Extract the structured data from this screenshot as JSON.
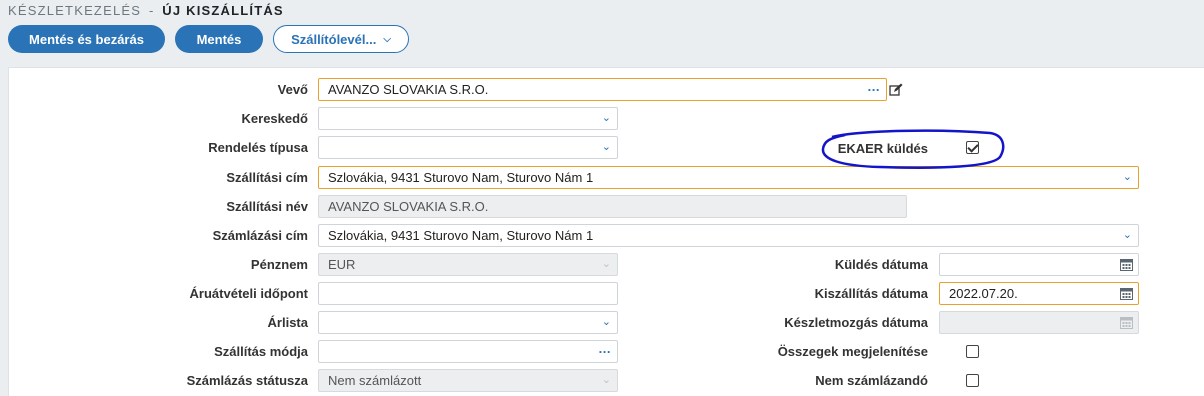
{
  "breadcrumb": {
    "parent": "KÉSZLETKEZELÉS",
    "separator": "-",
    "current": "ÚJ KISZÁLLÍTÁS"
  },
  "toolbar": {
    "save_close_label": "Mentés és bezárás",
    "save_label": "Mentés",
    "delivery_note_label": "Szállítólevél...",
    "chevron_icon": "chevron-down-icon"
  },
  "form": {
    "vevo": {
      "label": "Vevő",
      "value": "AVANZO SLOVAKIA S.R.O."
    },
    "kereskedo": {
      "label": "Kereskedő",
      "value": ""
    },
    "rendeles_tipusa": {
      "label": "Rendelés típusa",
      "value": ""
    },
    "ekaer": {
      "label": "EKAER küldés",
      "checked": true
    },
    "szallitasi_cim": {
      "label": "Szállítási cím",
      "value": "Szlovákia, 9431 Sturovo Nam, Sturovo Nám 1"
    },
    "szallitasi_nev": {
      "label": "Szállítási név",
      "value": "AVANZO SLOVAKIA S.R.O."
    },
    "szamlazasi_cim": {
      "label": "Számlázási cím",
      "value": "Szlovákia, 9431 Sturovo Nam, Sturovo Nám 1"
    },
    "penznem": {
      "label": "Pénznem",
      "value": "EUR"
    },
    "aruatveteli_idopont": {
      "label": "Áruátvételi időpont",
      "value": ""
    },
    "arlista": {
      "label": "Árlista",
      "value": ""
    },
    "szallitas_modja": {
      "label": "Szállítás módja",
      "value": ""
    },
    "szamlazas_statusza": {
      "label": "Számlázás státusza",
      "value": "Nem számlázott"
    },
    "kuldes_datuma": {
      "label": "Küldés dátuma",
      "value": ""
    },
    "kiszallitas_datuma": {
      "label": "Kiszállítás dátuma",
      "value": "2022.07.20."
    },
    "keszletmozgas_datuma": {
      "label": "Készletmozgás dátuma",
      "value": ""
    },
    "osszegek_megjelenitese": {
      "label": "Összegek megjelenítése",
      "checked": false
    },
    "nem_szamlazando": {
      "label": "Nem számlázandó",
      "checked": false
    }
  },
  "colors": {
    "accent": "#2a73b7",
    "required_border": "#e8a12c",
    "annotation": "#1414c8"
  }
}
